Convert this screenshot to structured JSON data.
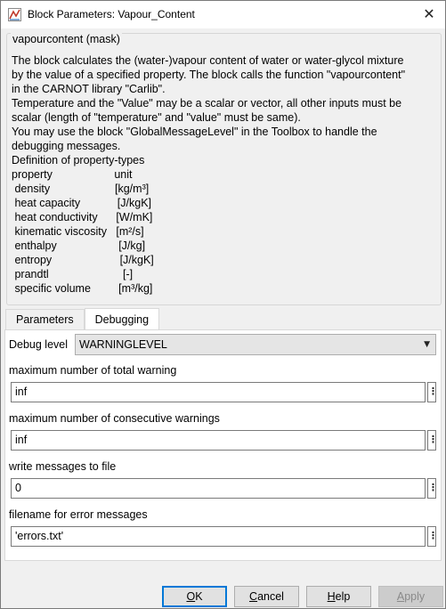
{
  "window": {
    "title": "Block Parameters: Vapour_Content",
    "close_glyph": "✕"
  },
  "mask": {
    "title": "vapourcontent (mask)",
    "description": [
      "The block calculates the (water-)vapour content of water or water-glycol mixture",
      "by the value of a specified property. The block calls the function \"vapourcontent\"",
      "in the CARNOT library \"Carlib\".",
      "Temperature and the \"Value\" may be a scalar or vector, all other inputs must be",
      "scalar (length of \"temperature\" and \"value\" must be same).",
      "You may use the block \"GlobalMessageLevel\" in the Toolbox to handle the",
      "debugging messages.",
      "Definition of property-types",
      "property                    unit",
      " density                     [kg/m³]",
      " heat capacity            [J/kgK]",
      " heat conductivity      [W/mK]",
      " kinematic viscosity   [m²/s]",
      " enthalpy                    [J/kg]",
      " entropy                      [J/kgK]",
      " prandtl                        [-]",
      " specific volume         [m³/kg]"
    ]
  },
  "tabs": [
    {
      "label": "Parameters",
      "active": false
    },
    {
      "label": "Debugging",
      "active": true
    }
  ],
  "debugging": {
    "debug_level_label": "Debug level",
    "debug_level_value": "WARNINGLEVEL",
    "fields": [
      {
        "label": "maximum number of total warning",
        "value": "inf"
      },
      {
        "label": "maximum number of consecutive warnings",
        "value": "inf"
      },
      {
        "label": "write messages to file",
        "value": "0"
      },
      {
        "label": "filename for error messages",
        "value": "'errors.txt'"
      }
    ],
    "kebab_glyph": "⋮"
  },
  "buttons": {
    "ok": {
      "label": "OK",
      "mnemonic": "O",
      "rest": "K"
    },
    "cancel": {
      "label": "Cancel",
      "mnemonic": "C",
      "rest": "ancel"
    },
    "help": {
      "label": "Help",
      "mnemonic": "H",
      "rest": "elp"
    },
    "apply": {
      "label": "Apply",
      "mnemonic": "A",
      "rest": "pply"
    }
  },
  "colors": {
    "default_button_border": "#0078d7",
    "app_icon": "#c0392b"
  }
}
